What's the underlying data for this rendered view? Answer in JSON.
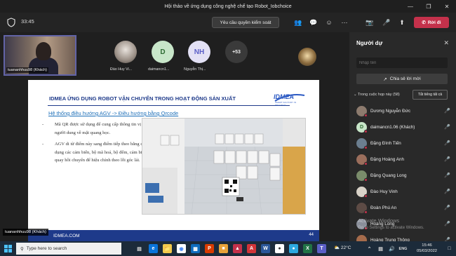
{
  "window": {
    "title": "Hội thảo về ứng dụng công nghệ chế tạo Robot_Iobchoice"
  },
  "toolbar": {
    "timer": "33:45",
    "request_control": "Yêu cầu quyền kiểm soát",
    "leave": "Rời đi"
  },
  "participants_strip": {
    "presenter_name": "tuananhhuu98 (Khách)",
    "tiles": [
      {
        "label": "Đào Huy Vi...",
        "initials": ""
      },
      {
        "label": "daimancn1...",
        "initials": "D"
      },
      {
        "label": "Nguyễn Thị...",
        "initials": "NH"
      },
      {
        "label": "",
        "initials": "+53"
      }
    ]
  },
  "slide": {
    "title": "IDMEA ỨNG DỤNG ROBOT VẬN CHUYỂN TRONG HOẠT ĐỘNG SẢN XUẤT",
    "logo": "IDMEA",
    "logo_sub": "SMART FACTORY IN PRACTICE",
    "subtitle": "Hệ thống điều hướng AGV -> Điều hướng bằng Qrcode",
    "bullets": [
      "Mã QR được sử dụng để cung cấp thông tin vị trí cho người dung về mặt quang học.",
      "AGV di từ điểm này sang điểm tiếp theo bằng cách sử dụng các cảm biến, bộ mã hoá, bộ đếm, cảm biến con quay hồi chuyển để hiệu chỉnh theo lỗi góc lái."
    ],
    "footer": "IDMEA.COM",
    "page": "44",
    "presenter_tag": "tuananhhuu98 (Khách)"
  },
  "panel": {
    "title": "Người dự",
    "search_placeholder": "Nhập tên",
    "share_invite": "Chia sẻ lời mời",
    "section": "Trong cuộc họp này (58)",
    "mute_all": "Tắt tiếng tất cả",
    "people": [
      {
        "name": "Dương Nguyễn Đức",
        "initial": "",
        "color": "#8d7b6e"
      },
      {
        "name": "daimancn1.06 (Khách)",
        "initial": "D",
        "color": "#c8e6c9"
      },
      {
        "name": "Đặng Đình Tiến",
        "initial": "",
        "color": "#6b7e8f"
      },
      {
        "name": "Đặng Hoàng Anh",
        "initial": "",
        "color": "#9b6e5c"
      },
      {
        "name": "Đặng Quang Long",
        "initial": "",
        "color": "#7a8c6b"
      },
      {
        "name": "Đào Huy Vinh",
        "initial": "",
        "color": "#d8d2c8"
      },
      {
        "name": "Đoàn Phú An",
        "initial": "",
        "color": "#5d4b45"
      },
      {
        "name": "Hoàng Long",
        "initial": "",
        "color": "#8a8f9a"
      },
      {
        "name": "Hoàng Trung Thông",
        "initial": "",
        "color": "#a56b4b"
      }
    ]
  },
  "watermark": {
    "line1": "Activate Windows",
    "line2": "Go to Settings to activate Windows."
  },
  "taskbar": {
    "search_placeholder": "Type here to search",
    "weather": "22°C",
    "time": "15:46",
    "date": "05/03/2022"
  },
  "colors": {
    "accent": "#6264a7",
    "leave": "#c4314b",
    "slide_blue": "#1e3a8a"
  }
}
